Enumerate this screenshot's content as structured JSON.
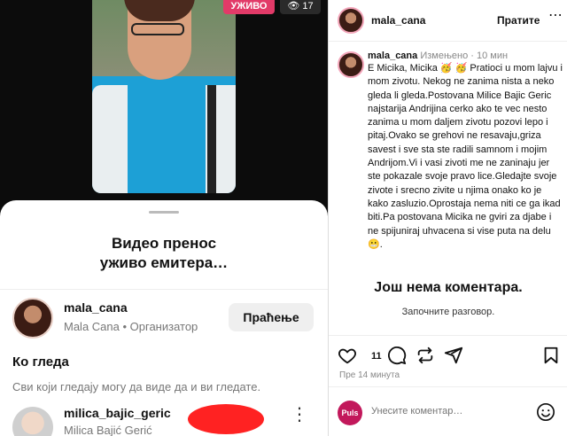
{
  "stream": {
    "live_badge": "УЖИВО",
    "viewer_count": "17",
    "sheet_title_line1": "Видео пренос",
    "sheet_title_line2": "уживо емитера…",
    "host_username": "mala_cana",
    "host_subtitle": "Mala Cana • Организатор",
    "follow_label": "Праћење",
    "viewers_heading": "Ко гледа",
    "viewers_description": "Сви који гледају могу да виде да и ви гледате.",
    "viewer_username": "milica_bajic_geric",
    "viewer_fullname": "Milica Bajić Gerić"
  },
  "post": {
    "username": "mala_cana",
    "follow_label": "Пратите",
    "comment_author": "mala_cana",
    "edited_label": "Измењено",
    "time_label": "10 мин",
    "caption": "E Micika, Micika 🥳 🥳 Pratioci u mom lajvu i mom zivotu. Nekog ne zanima nista a neko gleda li gleda.Postovana Milice Bajic Geric najstarija Andrijina cerko ako te vec nesto zanima u mom daljem zivotu pozovi lepo i pitaj.Ovako se grehovi ne resavaju,griza savest i sve sta ste radili samnom i mojim Andrijom.Vi i vasi zivoti me ne zaninaju jer ste pokazale svoje pravo lice.Gledajte svoje zivote i srecno zivite u njima onako ko je kako zasluzio.Oprostaja nema niti ce ga ikad biti.Pa postovana Micika ne gviri za djabe i ne spijuniraj uhvacena si vise puta na delu 😬.",
    "no_comments": "Још нема коментара.",
    "start_conversation": "Започните разговор.",
    "likes_count": "11",
    "time_ago": "Пре 14 минута",
    "commenter_badge": "Puls",
    "comment_placeholder": "Унесите коментар…"
  }
}
